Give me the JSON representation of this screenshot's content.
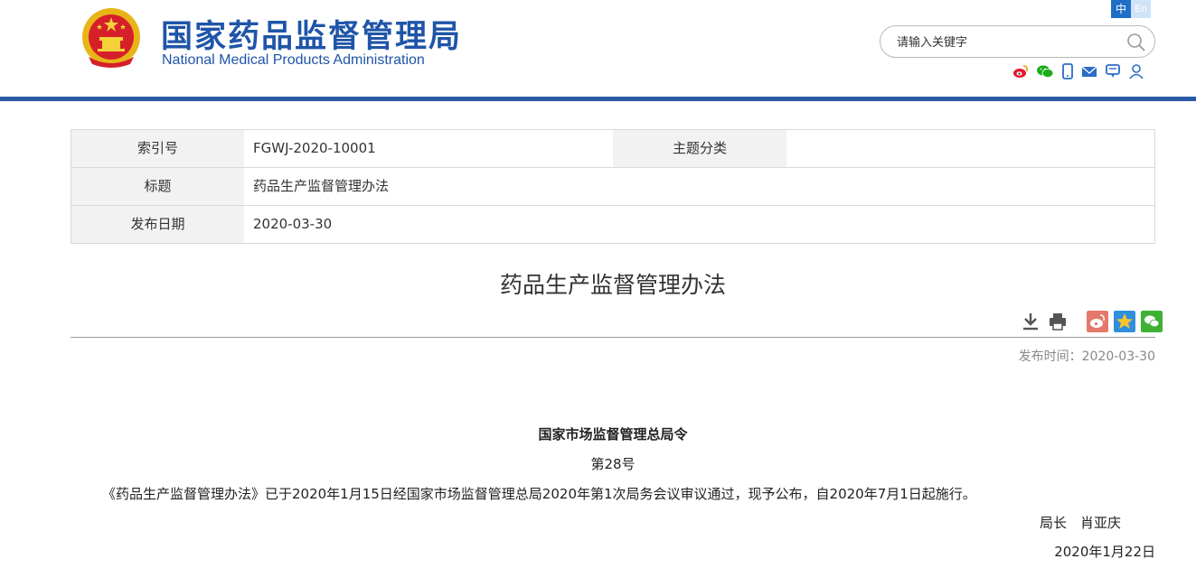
{
  "header": {
    "title_cn": "国家药品监督管理局",
    "title_en": "National Medical Products Administration",
    "lang_zh": "中",
    "lang_en": "En",
    "search_placeholder": "请输入关键字",
    "accent": "#2b5aa6",
    "social_icons": [
      "weibo-icon",
      "wechat-icon",
      "mobile-icon",
      "mail-icon",
      "message-icon",
      "user-icon"
    ]
  },
  "meta": {
    "index_label": "索引号",
    "index_value": "FGWJ-2020-10001",
    "topic_label": "主题分类",
    "topic_value": "",
    "title_label": "标题",
    "title_value": "药品生产监督管理办法",
    "date_label": "发布日期",
    "date_value": "2020-03-30"
  },
  "article": {
    "title": "药品生产监督管理办法",
    "tools": [
      "download-icon",
      "print-icon",
      "share-weibo-icon",
      "share-qzone-icon",
      "share-wechat-icon"
    ],
    "pubtime": "发布时间：2020-03-30",
    "decree_head": "国家市场监督管理总局令",
    "decree_no": "第28号",
    "decree_body": "《药品生产监督管理办法》已于2020年1月15日经国家市场监督管理总局2020年第1次局务会议审议通过，现予公布，自2020年7月1日起施行。",
    "decree_sign": "局长　肖亚庆",
    "decree_date": "2020年1月22日"
  }
}
